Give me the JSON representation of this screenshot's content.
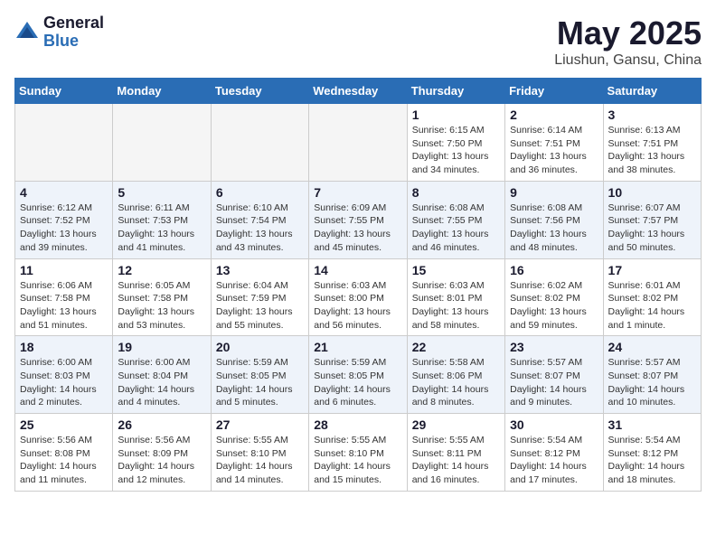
{
  "logo": {
    "general": "General",
    "blue": "Blue"
  },
  "title": "May 2025",
  "subtitle": "Liushun, Gansu, China",
  "weekdays": [
    "Sunday",
    "Monday",
    "Tuesday",
    "Wednesday",
    "Thursday",
    "Friday",
    "Saturday"
  ],
  "weeks": [
    [
      {
        "day": "",
        "info": ""
      },
      {
        "day": "",
        "info": ""
      },
      {
        "day": "",
        "info": ""
      },
      {
        "day": "",
        "info": ""
      },
      {
        "day": "1",
        "info": "Sunrise: 6:15 AM\nSunset: 7:50 PM\nDaylight: 13 hours\nand 34 minutes."
      },
      {
        "day": "2",
        "info": "Sunrise: 6:14 AM\nSunset: 7:51 PM\nDaylight: 13 hours\nand 36 minutes."
      },
      {
        "day": "3",
        "info": "Sunrise: 6:13 AM\nSunset: 7:51 PM\nDaylight: 13 hours\nand 38 minutes."
      }
    ],
    [
      {
        "day": "4",
        "info": "Sunrise: 6:12 AM\nSunset: 7:52 PM\nDaylight: 13 hours\nand 39 minutes."
      },
      {
        "day": "5",
        "info": "Sunrise: 6:11 AM\nSunset: 7:53 PM\nDaylight: 13 hours\nand 41 minutes."
      },
      {
        "day": "6",
        "info": "Sunrise: 6:10 AM\nSunset: 7:54 PM\nDaylight: 13 hours\nand 43 minutes."
      },
      {
        "day": "7",
        "info": "Sunrise: 6:09 AM\nSunset: 7:55 PM\nDaylight: 13 hours\nand 45 minutes."
      },
      {
        "day": "8",
        "info": "Sunrise: 6:08 AM\nSunset: 7:55 PM\nDaylight: 13 hours\nand 46 minutes."
      },
      {
        "day": "9",
        "info": "Sunrise: 6:08 AM\nSunset: 7:56 PM\nDaylight: 13 hours\nand 48 minutes."
      },
      {
        "day": "10",
        "info": "Sunrise: 6:07 AM\nSunset: 7:57 PM\nDaylight: 13 hours\nand 50 minutes."
      }
    ],
    [
      {
        "day": "11",
        "info": "Sunrise: 6:06 AM\nSunset: 7:58 PM\nDaylight: 13 hours\nand 51 minutes."
      },
      {
        "day": "12",
        "info": "Sunrise: 6:05 AM\nSunset: 7:58 PM\nDaylight: 13 hours\nand 53 minutes."
      },
      {
        "day": "13",
        "info": "Sunrise: 6:04 AM\nSunset: 7:59 PM\nDaylight: 13 hours\nand 55 minutes."
      },
      {
        "day": "14",
        "info": "Sunrise: 6:03 AM\nSunset: 8:00 PM\nDaylight: 13 hours\nand 56 minutes."
      },
      {
        "day": "15",
        "info": "Sunrise: 6:03 AM\nSunset: 8:01 PM\nDaylight: 13 hours\nand 58 minutes."
      },
      {
        "day": "16",
        "info": "Sunrise: 6:02 AM\nSunset: 8:02 PM\nDaylight: 13 hours\nand 59 minutes."
      },
      {
        "day": "17",
        "info": "Sunrise: 6:01 AM\nSunset: 8:02 PM\nDaylight: 14 hours\nand 1 minute."
      }
    ],
    [
      {
        "day": "18",
        "info": "Sunrise: 6:00 AM\nSunset: 8:03 PM\nDaylight: 14 hours\nand 2 minutes."
      },
      {
        "day": "19",
        "info": "Sunrise: 6:00 AM\nSunset: 8:04 PM\nDaylight: 14 hours\nand 4 minutes."
      },
      {
        "day": "20",
        "info": "Sunrise: 5:59 AM\nSunset: 8:05 PM\nDaylight: 14 hours\nand 5 minutes."
      },
      {
        "day": "21",
        "info": "Sunrise: 5:59 AM\nSunset: 8:05 PM\nDaylight: 14 hours\nand 6 minutes."
      },
      {
        "day": "22",
        "info": "Sunrise: 5:58 AM\nSunset: 8:06 PM\nDaylight: 14 hours\nand 8 minutes."
      },
      {
        "day": "23",
        "info": "Sunrise: 5:57 AM\nSunset: 8:07 PM\nDaylight: 14 hours\nand 9 minutes."
      },
      {
        "day": "24",
        "info": "Sunrise: 5:57 AM\nSunset: 8:07 PM\nDaylight: 14 hours\nand 10 minutes."
      }
    ],
    [
      {
        "day": "25",
        "info": "Sunrise: 5:56 AM\nSunset: 8:08 PM\nDaylight: 14 hours\nand 11 minutes."
      },
      {
        "day": "26",
        "info": "Sunrise: 5:56 AM\nSunset: 8:09 PM\nDaylight: 14 hours\nand 12 minutes."
      },
      {
        "day": "27",
        "info": "Sunrise: 5:55 AM\nSunset: 8:10 PM\nDaylight: 14 hours\nand 14 minutes."
      },
      {
        "day": "28",
        "info": "Sunrise: 5:55 AM\nSunset: 8:10 PM\nDaylight: 14 hours\nand 15 minutes."
      },
      {
        "day": "29",
        "info": "Sunrise: 5:55 AM\nSunset: 8:11 PM\nDaylight: 14 hours\nand 16 minutes."
      },
      {
        "day": "30",
        "info": "Sunrise: 5:54 AM\nSunset: 8:12 PM\nDaylight: 14 hours\nand 17 minutes."
      },
      {
        "day": "31",
        "info": "Sunrise: 5:54 AM\nSunset: 8:12 PM\nDaylight: 14 hours\nand 18 minutes."
      }
    ]
  ]
}
